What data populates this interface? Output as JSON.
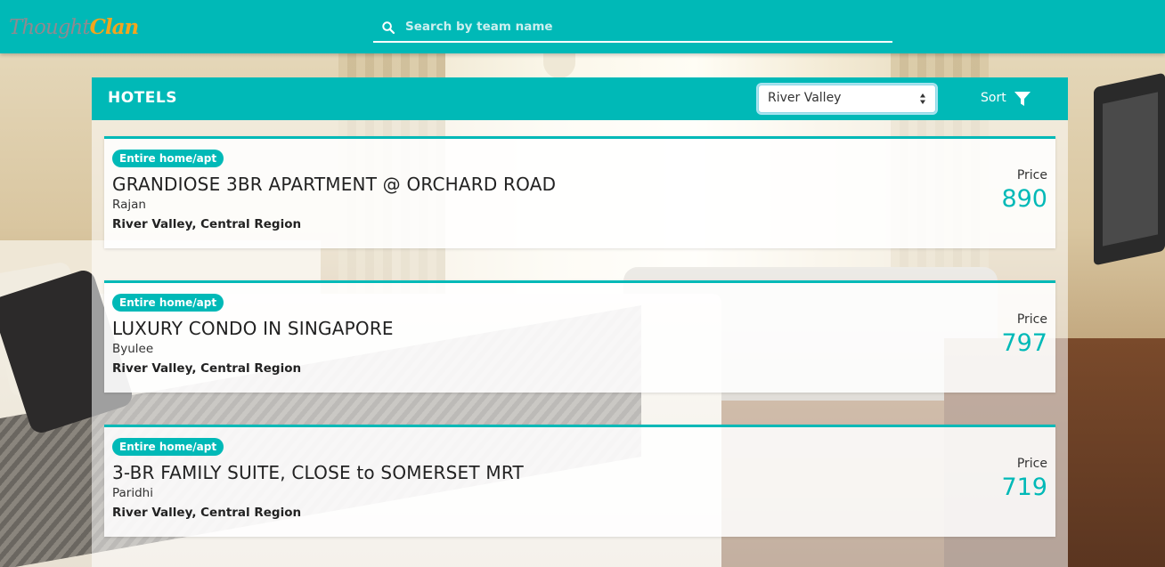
{
  "app": {
    "logo_part1": "Thought",
    "logo_part2": "Clan"
  },
  "search": {
    "placeholder": "Search by team name",
    "value": ""
  },
  "panel": {
    "title": "HOTELS",
    "city_select": {
      "selected": "River Valley"
    },
    "sort_label": "Sort"
  },
  "hotels": [
    {
      "badge": "Entire home/apt",
      "name": "GRANDIOSE 3BR APARTMENT @ ORCHARD ROAD",
      "host": "Rajan",
      "location": "River Valley, Central Region",
      "price_label": "Price",
      "price": "890"
    },
    {
      "badge": "Entire home/apt",
      "name": "LUXURY CONDO IN SINGAPORE",
      "host": "Byulee",
      "location": "River Valley, Central Region",
      "price_label": "Price",
      "price": "797"
    },
    {
      "badge": "Entire home/apt",
      "name": "3-BR FAMILY SUITE, CLOSE to SOMERSET MRT",
      "host": "Paridhi",
      "location": "River Valley, Central Region",
      "price_label": "Price",
      "price": "719"
    }
  ],
  "colors": {
    "accent": "#00b9b7",
    "logo_grey": "#8f8a90",
    "logo_orange": "#f3a51d"
  },
  "icons": {
    "search": "search-icon",
    "sort": "filter-icon",
    "select_arrows": "select-arrows-icon"
  }
}
